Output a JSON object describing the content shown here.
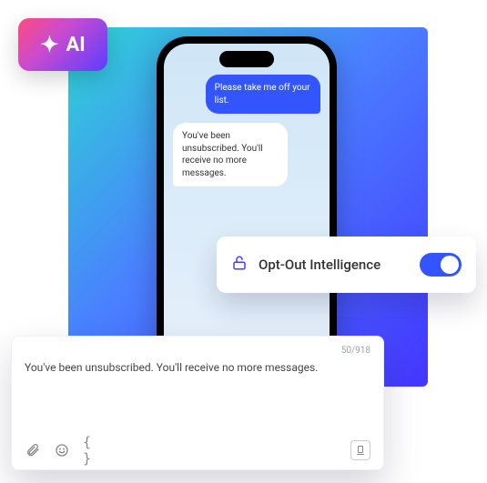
{
  "aiBadge": {
    "label": "AI"
  },
  "chat": {
    "sent": "Please take me off your list.",
    "received": "You've been unsubscribed. You'll receive no more messages."
  },
  "featureCard": {
    "label": "Opt-Out Intelligence",
    "toggleOn": true
  },
  "composer": {
    "counter": "50/918",
    "text": "You've been unsubscribed. You'll receive no more messages."
  }
}
